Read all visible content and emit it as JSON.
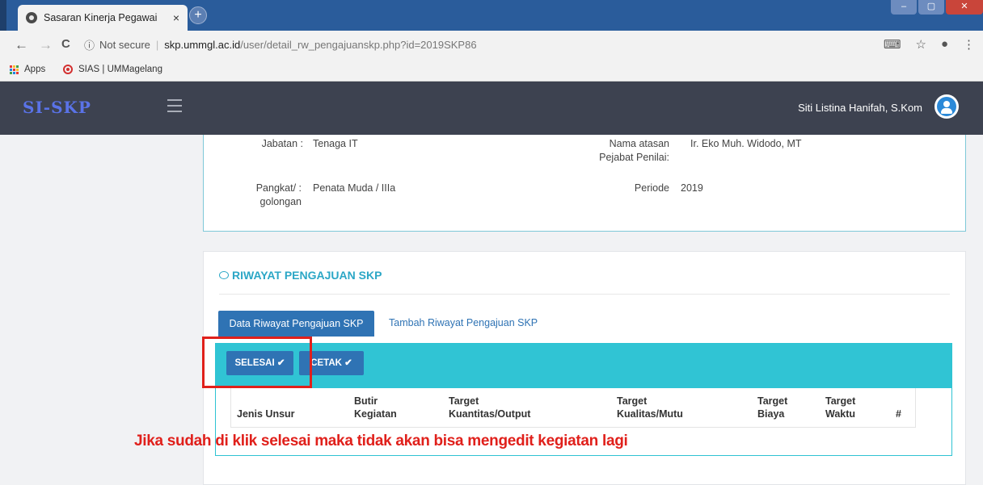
{
  "browser": {
    "tab_title": "Sasaran Kinerja Pegawai",
    "tab_close": "×",
    "new_tab": "+",
    "window_buttons": [
      "–",
      "▢",
      "✕"
    ],
    "nav": {
      "back": "←",
      "forward": "→",
      "reload": "C"
    },
    "security": "Not secure",
    "url_host": "skp.ummgl.ac.id",
    "url_path": "/user/detail_rw_pengajuanskp.php?id=2019SKP86",
    "bookmarks": [
      "Apps",
      "SIAS | UMMagelang"
    ]
  },
  "app": {
    "brand": "SI-SKP",
    "user_name": "Siti Listina Hanifah, S.Kom"
  },
  "profile": {
    "jabatan_label": "Jabatan :",
    "jabatan_value": "Tenaga IT",
    "pangkat_label_1": "Pangkat/ :",
    "pangkat_label_2": "golongan",
    "pangkat_value": "Penata Muda / IIIa",
    "atasan_label_1": "Nama atasan",
    "atasan_label_2": "Pejabat Penilai:",
    "atasan_value": "Ir. Eko Muh. Widodo, MT",
    "periode_label": "Periode",
    "periode_value": "2019"
  },
  "riwayat": {
    "title": "RIWAYAT PENGAJUAN SKP",
    "tab_active": "Data Riwayat Pengajuan SKP",
    "tab_other": "Tambah Riwayat Pengajuan SKP",
    "btn_selesai": "SELESAI ✔",
    "btn_cetak": "CETAK ✔",
    "columns": [
      {
        "line1": "",
        "line2": "Jenis Unsur"
      },
      {
        "line1": "Butir",
        "line2": "Kegiatan"
      },
      {
        "line1": "Target",
        "line2": "Kuantitas/Output"
      },
      {
        "line1": "Target",
        "line2": "Kualitas/Mutu"
      },
      {
        "line1": "Target",
        "line2": "Biaya"
      },
      {
        "line1": "Target",
        "line2": "Waktu"
      },
      {
        "line1": "",
        "line2": "#"
      }
    ]
  },
  "annotation": "Jika sudah di klik selesai maka tidak akan bisa mengedit kegiatan lagi",
  "colors": {
    "header_bg": "#3d4250",
    "brand": "#5a73e8",
    "primary": "#2f73b4",
    "teal": "#30c4d4",
    "annotation_red": "#e0201b"
  }
}
